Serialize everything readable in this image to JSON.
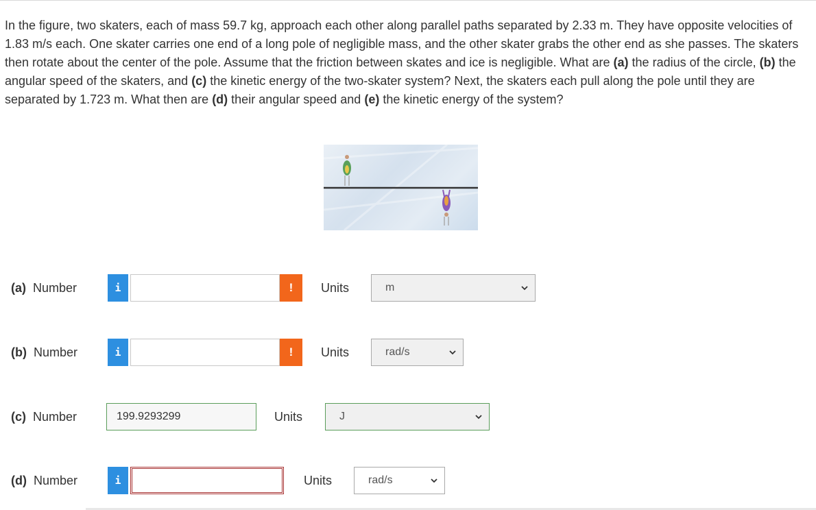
{
  "question": {
    "segments": [
      {
        "text": "In the figure, two skaters, each of mass 59.7 kg, approach each other along parallel paths separated by 2.33 m. They have opposite velocities of 1.83 m/s each. One skater carries one end of a long pole of negligible mass, and the other skater grabs the other end as she passes. The skaters then rotate about the center of the pole. Assume that the friction between skates and ice is negligible. What are ",
        "bold": false
      },
      {
        "text": "(a)",
        "bold": true
      },
      {
        "text": " the radius of the circle, ",
        "bold": false
      },
      {
        "text": "(b)",
        "bold": true
      },
      {
        "text": " the angular speed of the skaters, and ",
        "bold": false
      },
      {
        "text": "(c)",
        "bold": true
      },
      {
        "text": " the kinetic energy of the two-skater system? Next, the skaters each pull along the pole until they are separated by 1.723 m. What then are ",
        "bold": false
      },
      {
        "text": "(d)",
        "bold": true
      },
      {
        "text": " their angular speed and ",
        "bold": false
      },
      {
        "text": "(e)",
        "bold": true
      },
      {
        "text": " the kinetic energy of the system?",
        "bold": false
      }
    ]
  },
  "colors": {
    "info": "#2d8fe0",
    "warning": "#f2661b",
    "correct_border": "#5a9d5a",
    "error_border": "#a83232"
  },
  "parts": {
    "a": {
      "label": "(a)",
      "number_label": "Number",
      "value": "",
      "units_label": "Units",
      "unit": "m",
      "icon": "info-icon",
      "status_icon": "warning-icon"
    },
    "b": {
      "label": "(b)",
      "number_label": "Number",
      "value": "",
      "units_label": "Units",
      "unit": "rad/s",
      "icon": "info-icon",
      "status_icon": "warning-icon"
    },
    "c": {
      "label": "(c)",
      "number_label": "Number",
      "value": "199.9293299",
      "units_label": "Units",
      "unit": "J"
    },
    "d": {
      "label": "(d)",
      "number_label": "Number",
      "value": "",
      "units_label": "Units",
      "unit": "rad/s",
      "icon": "info-icon"
    }
  },
  "glyphs": {
    "info": "i",
    "warning": "!"
  }
}
